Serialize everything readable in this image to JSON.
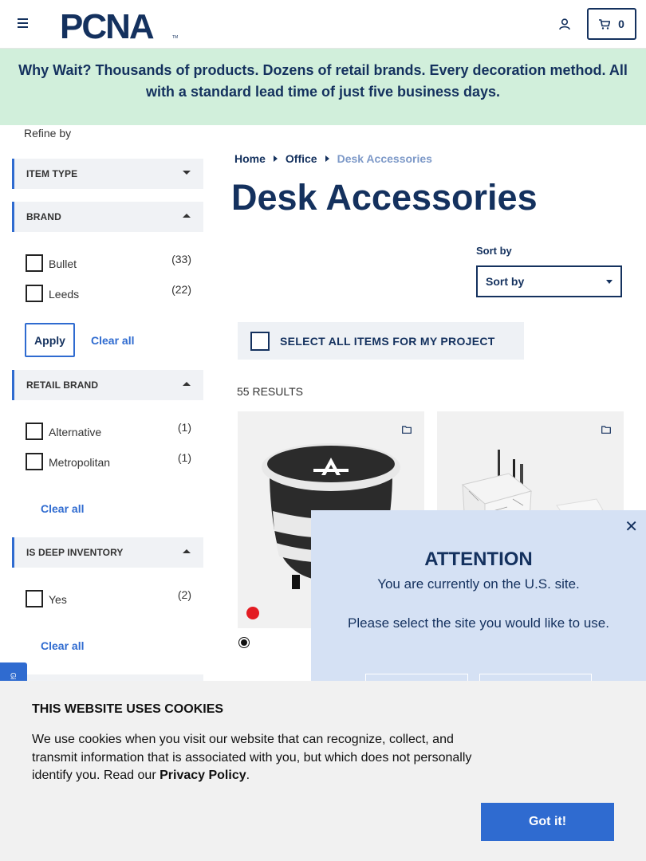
{
  "header": {
    "logo_text": "PCNA",
    "cart_count": "0"
  },
  "banner": {
    "text": "Why Wait? Thousands of products. Dozens of retail brands. Every decoration method. All with a standard lead time of just five business days."
  },
  "sidebar": {
    "refine_label": "Refine by",
    "facets": [
      {
        "title": "ITEM TYPE",
        "expanded": false,
        "options": []
      },
      {
        "title": "BRAND",
        "expanded": true,
        "options": [
          {
            "label": "Bullet",
            "count": "(33)"
          },
          {
            "label": "Leeds",
            "count": "(22)"
          }
        ]
      },
      {
        "title": "RETAIL BRAND",
        "expanded": true,
        "options": [
          {
            "label": "Alternative",
            "count": "(1)"
          },
          {
            "label": "Metropolitan",
            "count": "(1)"
          }
        ]
      },
      {
        "title": "IS DEEP INVENTORY",
        "expanded": true,
        "options": [
          {
            "label": "Yes",
            "count": "(2)"
          }
        ]
      }
    ],
    "apply_label": "Apply",
    "clear_all_label": "Clear all"
  },
  "breadcrumb": [
    "Home",
    "Office",
    "Desk Accessories"
  ],
  "page_title": "Desk Accessories",
  "sort": {
    "label": "Sort by",
    "value": "Sort by"
  },
  "select_all_label": "SELECT ALL ITEMS FOR MY PROJECT",
  "results_label": "55 RESULTS",
  "modal": {
    "title": "ATTENTION",
    "line1": "You are currently on the U.S. site.",
    "line2": "Please select the site you would like to use."
  },
  "side_tab_label": "Gi",
  "cookie": {
    "title": "THIS WEBSITE USES COOKIES",
    "text": "We use cookies when you visit our website that can recognize, collect, and transmit information that is associated with you, but which does not personally identify you. Read our ",
    "link": "Privacy Policy",
    "period": ".",
    "button": "Got it!"
  },
  "colors": {
    "navy": "#14315e",
    "accent_blue": "#2f6bd0",
    "banner_green": "#d1efdb",
    "modal_bg": "#d5e1f4"
  }
}
